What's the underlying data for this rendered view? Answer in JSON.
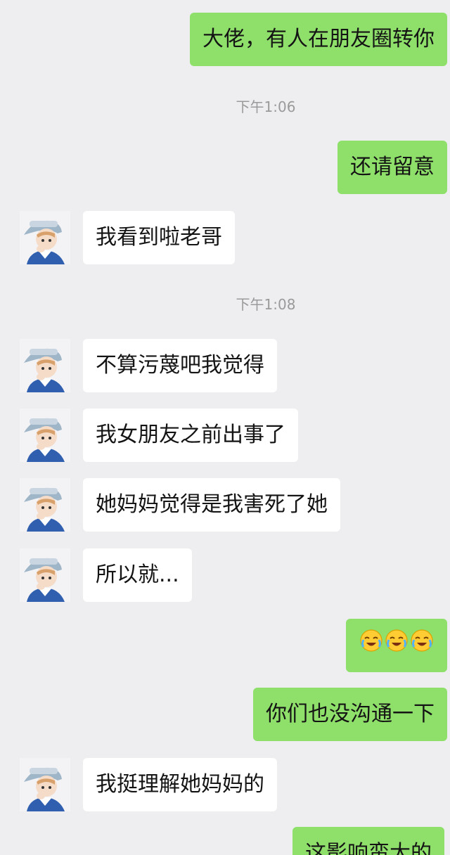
{
  "colors": {
    "background": "#eeeef1",
    "outgoing_bubble": "#8fe06b",
    "incoming_bubble": "#ffffff",
    "timestamp_text": "#9a9a9a"
  },
  "messages": [
    {
      "kind": "outgoing",
      "text": "大佬，有人在朋友圈转你"
    },
    {
      "kind": "timestamp",
      "text": "下午1:06"
    },
    {
      "kind": "outgoing",
      "text": "还请留意"
    },
    {
      "kind": "incoming",
      "text": "我看到啦老哥"
    },
    {
      "kind": "timestamp",
      "text": "下午1:08"
    },
    {
      "kind": "incoming",
      "text": "不算污蔑吧我觉得"
    },
    {
      "kind": "incoming",
      "text": "我女朋友之前出事了"
    },
    {
      "kind": "incoming",
      "text": "她妈妈觉得是我害死了她"
    },
    {
      "kind": "incoming",
      "text": "所以就..."
    },
    {
      "kind": "outgoing_emoji",
      "emojis": [
        "crying-laughing-emoji",
        "crying-laughing-emoji",
        "crying-laughing-emoji"
      ]
    },
    {
      "kind": "outgoing",
      "text": "你们也没沟通一下"
    },
    {
      "kind": "incoming",
      "text": "我挺理解她妈妈的"
    },
    {
      "kind": "outgoing",
      "text": "这影响蛮大的"
    }
  ]
}
